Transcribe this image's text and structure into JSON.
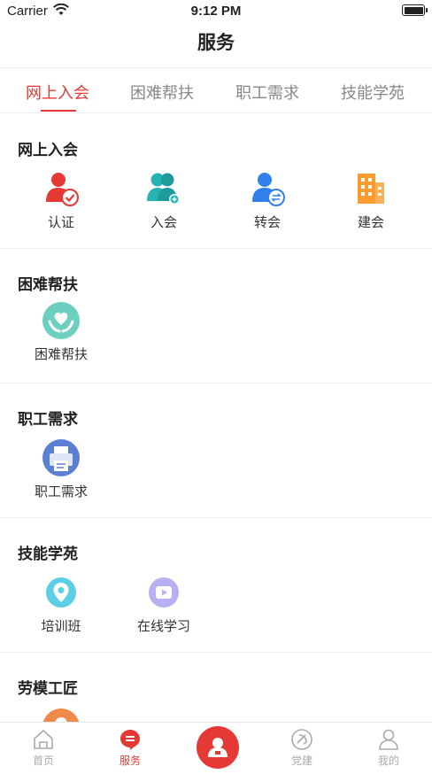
{
  "status_bar": {
    "carrier": "Carrier",
    "time": "9:12 PM"
  },
  "nav": {
    "title": "服务"
  },
  "tabs": [
    {
      "label": "网上入会",
      "active": true
    },
    {
      "label": "困难帮扶",
      "active": false
    },
    {
      "label": "职工需求",
      "active": false
    },
    {
      "label": "技能学苑",
      "active": false
    }
  ],
  "sections": [
    {
      "title": "网上入会",
      "items": [
        {
          "label": "认证",
          "icon": "person-check-icon"
        },
        {
          "label": "入会",
          "icon": "group-add-icon"
        },
        {
          "label": "转会",
          "icon": "person-transfer-icon"
        },
        {
          "label": "建会",
          "icon": "building-icon"
        }
      ]
    },
    {
      "title": "困难帮扶",
      "items": [
        {
          "label": "困难帮扶",
          "icon": "heart-hands-icon"
        }
      ]
    },
    {
      "title": "职工需求",
      "items": [
        {
          "label": "职工需求",
          "icon": "printer-icon"
        }
      ]
    },
    {
      "title": "技能学苑",
      "items": [
        {
          "label": "培训班",
          "icon": "location-pin-icon"
        },
        {
          "label": "在线学习",
          "icon": "video-play-icon"
        }
      ]
    },
    {
      "title": "劳模工匠",
      "items": [
        {
          "label": "",
          "icon": "worker-icon"
        }
      ]
    }
  ],
  "tabbar": [
    {
      "label": "首页",
      "icon": "home-icon",
      "active": false
    },
    {
      "label": "服务",
      "icon": "service-icon",
      "active": true
    },
    {
      "label": "",
      "icon": "person-badge-icon",
      "active": false
    },
    {
      "label": "党建",
      "icon": "party-emblem-icon",
      "active": false
    },
    {
      "label": "我的",
      "icon": "user-icon",
      "active": false
    }
  ],
  "colors": {
    "accent": "#e53935",
    "teal": "#26b3b3",
    "blue": "#2f80ed",
    "orange": "#ff9a2e"
  }
}
